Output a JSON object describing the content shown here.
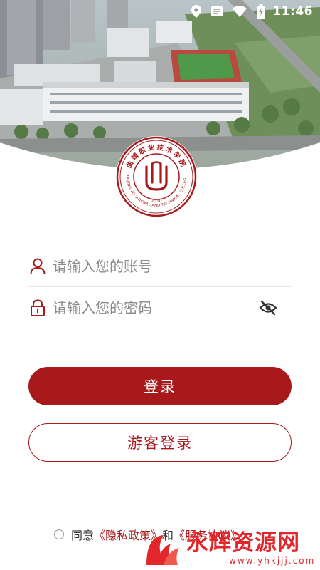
{
  "status_bar": {
    "time": "11:46"
  },
  "logo": {
    "name_cn": "曲靖职业技术学院",
    "name_en": "QUJING VOCATIONAL AND TECHNICAL COLLEGE",
    "year": "2010"
  },
  "form": {
    "account_placeholder": "请输入您的账号",
    "password_placeholder": "请输入您的密码"
  },
  "buttons": {
    "login": "登录",
    "guest_login": "游客登录"
  },
  "agreement": {
    "prefix": "同意",
    "privacy_link": "《隐私政策》",
    "and": "和",
    "service_link": "《服务协议》"
  },
  "watermark": {
    "text": "永辉资源网",
    "url": "www.yhkjjj.com"
  },
  "colors": {
    "brand": "#a8191c",
    "watermark": "#e3262b"
  }
}
